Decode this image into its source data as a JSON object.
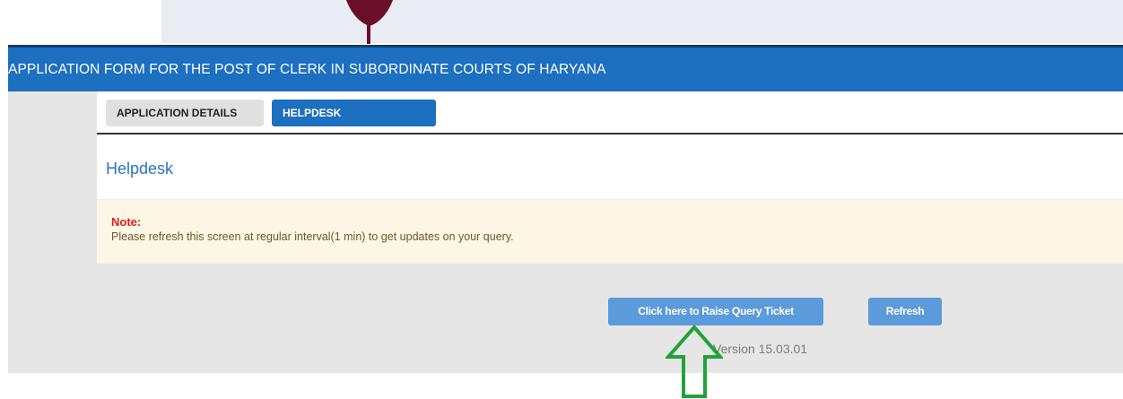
{
  "header": {
    "title": "APPLICATION FORM FOR THE POST OF CLERK IN SUBORDINATE COURTS OF HARYANA"
  },
  "tabs": [
    {
      "label": "APPLICATION DETAILS",
      "active": false
    },
    {
      "label": "HELPDESK",
      "active": true
    }
  ],
  "panel": {
    "heading": "Helpdesk",
    "note_label": "Note:",
    "note_text": "Please refresh this screen at regular interval(1 min) to get updates on your query."
  },
  "actions": {
    "raise_query_label": "Click here to Raise Query Ticket",
    "refresh_label": "Refresh"
  },
  "footer": {
    "version": "Version 15.03.01"
  },
  "icons": {
    "logo": "leaf-emblem-icon",
    "annotation": "up-arrow-icon"
  },
  "colors": {
    "primary": "#1d6fc0",
    "button": "#5b9bdc",
    "note_label": "#e02020",
    "note_background": "#fcf6e4",
    "annotation_arrow": "#1fa33a"
  }
}
